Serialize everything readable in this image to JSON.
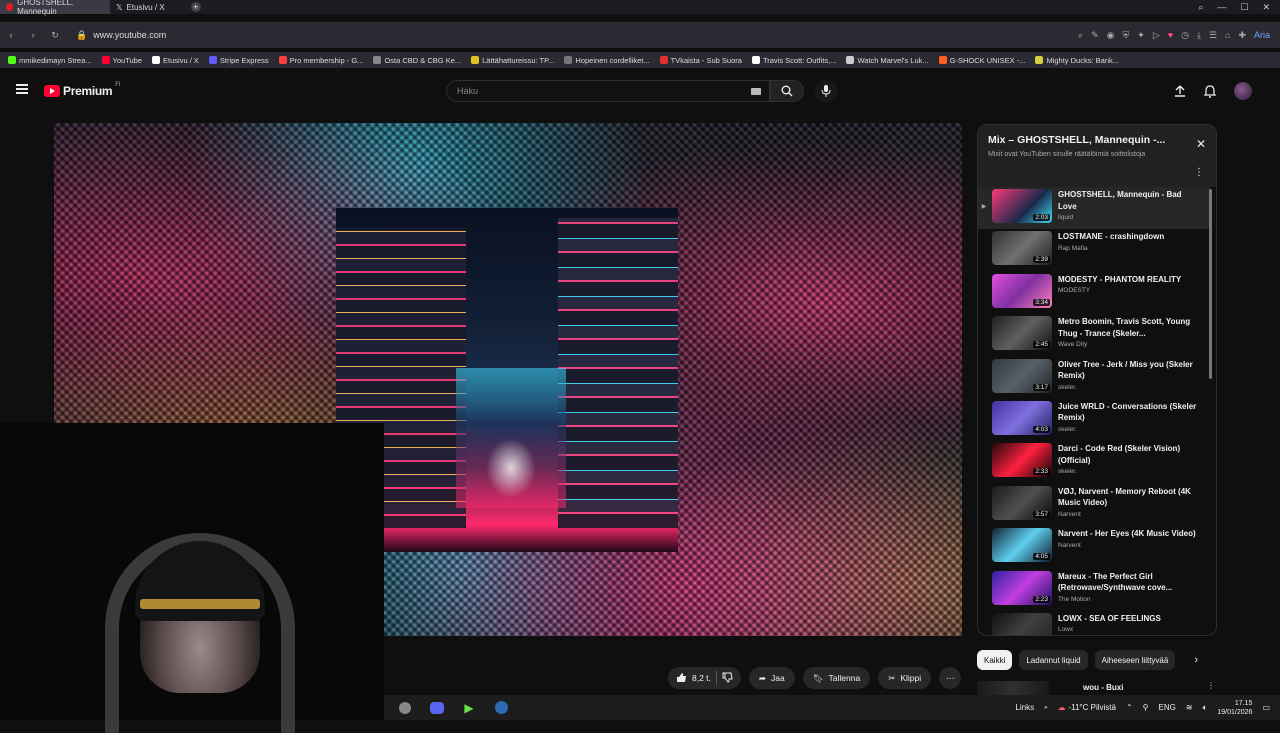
{
  "browser": {
    "tabs": [
      {
        "title": "GHOSTSHELL, Mannequin",
        "active": true,
        "color": "#e02020"
      },
      {
        "title": "Etusivu / X",
        "active": false,
        "color": "#ffffff"
      }
    ],
    "url": "www.youtube.com",
    "bookmarks": [
      {
        "label": "mmikedimayn Strea...",
        "color": "#53fc18"
      },
      {
        "label": "YouTube",
        "color": "#ff0033"
      },
      {
        "label": "Etusivu / X",
        "color": "#ffffff"
      },
      {
        "label": "Stripe Express",
        "color": "#635bff"
      },
      {
        "label": "Pro membership - G...",
        "color": "#ff4040"
      },
      {
        "label": "Osta CBD & CBG Ke...",
        "color": "#888888"
      },
      {
        "label": "Lättähattureissu: TP...",
        "color": "#e0c020"
      },
      {
        "label": "Hopeinen cordelliket...",
        "color": "#777777"
      },
      {
        "label": "TVkaista - Sub Suora",
        "color": "#e03030"
      },
      {
        "label": "Travis Scott: Outfits,...",
        "color": "#ffffff"
      },
      {
        "label": "Watch Marvel's Luk...",
        "color": "#cccccc"
      },
      {
        "label": "G-SHOCK UNISEX -...",
        "color": "#ff6020"
      },
      {
        "label": "Mighty Ducks: Bank...",
        "color": "#d0d040"
      }
    ]
  },
  "youtube": {
    "logo_text": "Premium",
    "logo_sup": "FI",
    "search_placeholder": "Haku"
  },
  "actions": {
    "likes": "8,2 t.",
    "share": "Jaa",
    "save": "Tallenna",
    "clip": "Klippi"
  },
  "playlist": {
    "title": "Mix – GHOSTSHELL, Mannequin -...",
    "subtitle": "Mixit ovat YouTuben sinulle räätälöimiä soittolistoja",
    "items": [
      {
        "title": "GHOSTSHELL, Mannequin - Bad Love",
        "channel": "liquid",
        "duration": "2:03",
        "current": true,
        "thumb": "linear-gradient(135deg,#ff3a7a,#1a2a4a 60%,#40e0ff)"
      },
      {
        "title": "LOSTMANE - crashingdown",
        "channel": "Rap Mafia",
        "duration": "2:39",
        "current": false,
        "thumb": "linear-gradient(135deg,#303030,#707070 50%,#202020)"
      },
      {
        "title": "MODESTY - PHANTOM REALITY",
        "channel": "MODESTY",
        "duration": "3:34",
        "current": false,
        "thumb": "linear-gradient(135deg,#e050e0,#8030a0 50%,#ff80c0)"
      },
      {
        "title": "Metro Boomin, Travis Scott, Young Thug - Trance (Skeler...",
        "channel": "Wave Dity",
        "duration": "2:45",
        "current": false,
        "thumb": "linear-gradient(135deg,#202020,#606060 50%,#101010)"
      },
      {
        "title": "Oliver Tree - Jerk / Miss you (Skeler Remix)",
        "channel": "skeler.",
        "duration": "3:17",
        "current": false,
        "thumb": "linear-gradient(135deg,#303840,#586068 50%,#202428)"
      },
      {
        "title": "Juice WRLD - Conversations (Skeler Remix)",
        "channel": "skeler.",
        "duration": "4:03",
        "current": false,
        "thumb": "linear-gradient(135deg,#4030a0,#8070e0 50%,#202060)"
      },
      {
        "title": "Darci - Code Red (Skeler Vision) (Official)",
        "channel": "skeler.",
        "duration": "2:33",
        "current": false,
        "thumb": "linear-gradient(135deg,#200808,#ff2040 50%,#100404)"
      },
      {
        "title": "VØJ, Narvent - Memory Reboot (4K Music Video)",
        "channel": "Narvent",
        "duration": "3:57",
        "current": false,
        "thumb": "linear-gradient(135deg,#1a1a1a,#505050 50%,#0a0a0a)"
      },
      {
        "title": "Narvent - Her Eyes (4K Music Video)",
        "channel": "Narvent",
        "duration": "4:05",
        "current": false,
        "thumb": "linear-gradient(135deg,#102030,#60d0f0 50%,#0a1828)"
      },
      {
        "title": "Mareux - The Perfect Girl (Retrowave/Synthwave cove...",
        "channel": "The Motion",
        "duration": "2:23",
        "current": false,
        "thumb": "linear-gradient(135deg,#3020a0,#c040e0 50%,#201060)"
      },
      {
        "title": "LOWX - SEA OF FEELINGS",
        "channel": "Lowx",
        "duration": "2:53",
        "current": false,
        "thumb": "linear-gradient(135deg,#101010,#404040 50%,#202020)"
      }
    ]
  },
  "chips": [
    "Kaikki",
    "Ladannut liquid",
    "Aiheeseen liittyvää"
  ],
  "recommendation": {
    "title": "wou - Buxi"
  },
  "taskbar": {
    "links_label": "Links",
    "weather": "-11°C  Pilvistä",
    "lang": "ENG",
    "time": "17.15",
    "date": "19/01/2026"
  }
}
